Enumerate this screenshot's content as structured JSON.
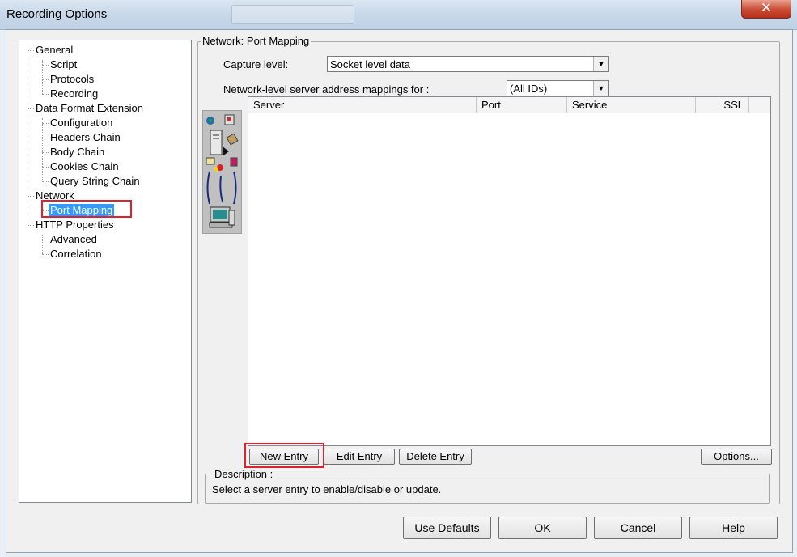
{
  "window": {
    "title": "Recording Options",
    "close_glyph": "✕"
  },
  "tree": {
    "items": [
      {
        "label": "General",
        "level": 0
      },
      {
        "label": "Script",
        "level": 1
      },
      {
        "label": "Protocols",
        "level": 1
      },
      {
        "label": "Recording",
        "level": 1
      },
      {
        "label": "Data Format Extension",
        "level": 0
      },
      {
        "label": "Configuration",
        "level": 1
      },
      {
        "label": "Headers Chain",
        "level": 1
      },
      {
        "label": "Body Chain",
        "level": 1
      },
      {
        "label": "Cookies Chain",
        "level": 1
      },
      {
        "label": "Query String Chain",
        "level": 1
      },
      {
        "label": "Network",
        "level": 0
      },
      {
        "label": "Port Mapping",
        "level": 1,
        "selected": true
      },
      {
        "label": "HTTP Properties",
        "level": 0
      },
      {
        "label": "Advanced",
        "level": 1
      },
      {
        "label": "Correlation",
        "level": 1
      }
    ]
  },
  "group": {
    "title": "Network: Port Mapping"
  },
  "capture": {
    "label": "Capture level:",
    "value": "Socket level data"
  },
  "mappings": {
    "label": "Network-level server address mappings for :",
    "value": "(All IDs)"
  },
  "table": {
    "columns": [
      "Server",
      "Port",
      "Service",
      "SSL"
    ],
    "rows": []
  },
  "buttons": {
    "new_entry": "New Entry",
    "edit_entry": "Edit Entry",
    "delete_entry": "Delete Entry",
    "options": "Options..."
  },
  "description": {
    "title": "Description :",
    "text": "Select a server entry to enable/disable or update."
  },
  "footer": {
    "use_defaults": "Use Defaults",
    "ok": "OK",
    "cancel": "Cancel",
    "help": "Help"
  },
  "colors": {
    "highlight": "#e0202e",
    "selection": "#3399ff"
  },
  "icons": [
    "globe-icon",
    "server-tower-icon",
    "network-cable-icon",
    "computer-icon"
  ]
}
